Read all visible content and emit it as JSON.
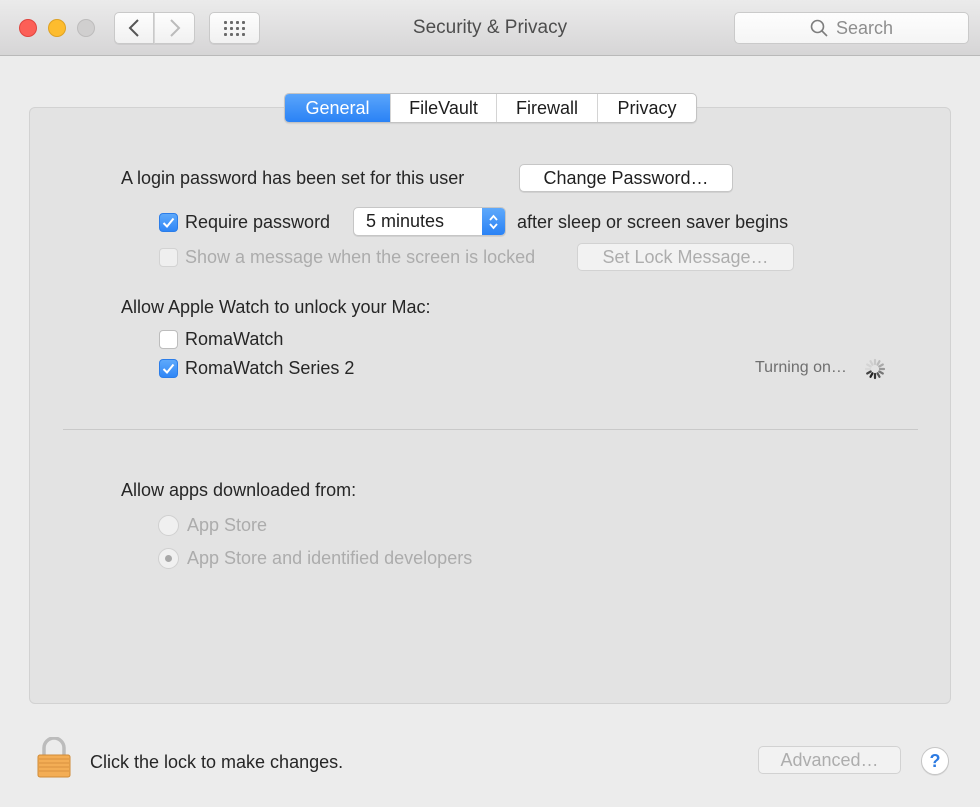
{
  "window": {
    "title": "Security & Privacy",
    "search_placeholder": "Search"
  },
  "toolbar": {
    "back_icon": "chevron-left-icon",
    "forward_icon": "chevron-right-icon",
    "show_all_icon": "grid-icon"
  },
  "tabs": [
    {
      "label": "General",
      "active": true
    },
    {
      "label": "FileVault",
      "active": false
    },
    {
      "label": "Firewall",
      "active": false
    },
    {
      "label": "Privacy",
      "active": false
    }
  ],
  "general": {
    "login_password_text": "A login password has been set for this user",
    "change_password_label": "Change Password…",
    "require_password": {
      "label": "Require password",
      "checked": true,
      "delay_value": "5 minutes",
      "suffix": "after sleep or screen saver begins"
    },
    "show_message": {
      "label": "Show a message when the screen is locked",
      "checked": false,
      "enabled": false,
      "button_label": "Set Lock Message…"
    },
    "apple_watch": {
      "heading": "Allow Apple Watch to unlock your Mac:",
      "devices": [
        {
          "name": "RomaWatch",
          "checked": false
        },
        {
          "name": "RomaWatch Series 2",
          "checked": true,
          "status": "Turning on…"
        }
      ]
    },
    "downloads": {
      "heading": "Allow apps downloaded from:",
      "options": [
        {
          "label": "App Store",
          "selected": false
        },
        {
          "label": "App Store and identified developers",
          "selected": true
        }
      ],
      "enabled": false
    }
  },
  "footer": {
    "lock_text": "Click the lock to make changes.",
    "advanced_label": "Advanced…",
    "help_label": "?"
  },
  "colors": {
    "accent": "#3389f7",
    "close": "#fc5f57",
    "minimize": "#fdbc2e",
    "zoom_disabled": "#d0cfcf",
    "lock": "#f0a84e"
  }
}
